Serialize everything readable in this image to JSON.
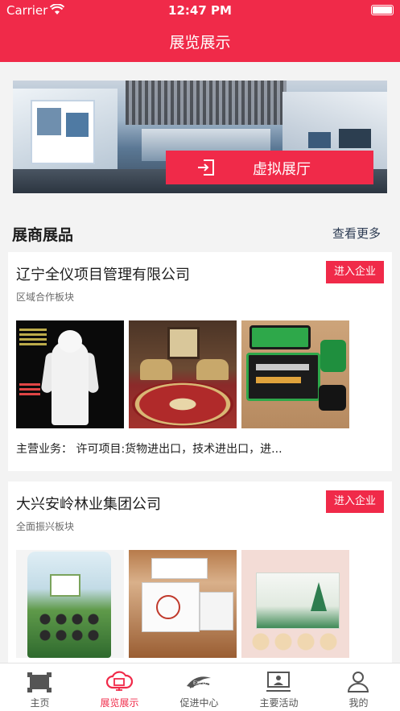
{
  "status_bar": {
    "carrier": "Carrier",
    "time": "12:47 PM"
  },
  "nav": {
    "title": "展览展示"
  },
  "banner": {
    "button_label": "虚拟展厅"
  },
  "section": {
    "title": "展商展品",
    "more_label": "查看更多"
  },
  "exhibitors": [
    {
      "name": "辽宁全仪项目管理有限公司",
      "enter_label": "进入企业",
      "sector": "区域合作板块",
      "business_label": "主营业务：",
      "business_text": "许可项目:货物进出口，技术进出口，进..."
    },
    {
      "name": "大兴安岭林业集团公司",
      "enter_label": "进入企业",
      "sector": "全面振兴板块"
    }
  ],
  "tabbar": {
    "items": [
      {
        "label": "主页",
        "icon": "home-icon"
      },
      {
        "label": "展览展示",
        "icon": "cloud-expo-icon"
      },
      {
        "label": "促进中心",
        "icon": "expo-logo-icon"
      },
      {
        "label": "主要活动",
        "icon": "presentation-icon"
      },
      {
        "label": "我的",
        "icon": "user-icon"
      }
    ],
    "active_index": 1
  },
  "colors": {
    "brand": "#f02a49",
    "background": "#f3f3f3"
  }
}
